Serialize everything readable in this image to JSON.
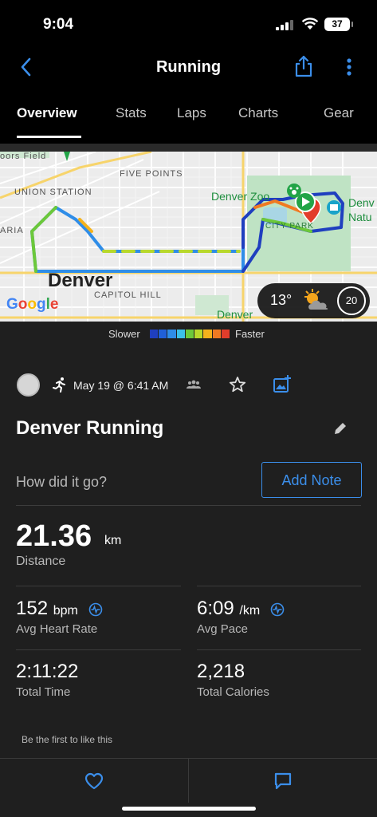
{
  "status_bar": {
    "time": "9:04",
    "battery": "37"
  },
  "header": {
    "title": "Running",
    "icons": [
      "back-chevron-icon",
      "share-icon",
      "more-vertical-icon"
    ]
  },
  "tabs": [
    {
      "label": "Overview",
      "active": true
    },
    {
      "label": "Stats",
      "active": false
    },
    {
      "label": "Laps",
      "active": false
    },
    {
      "label": "Charts",
      "active": false
    },
    {
      "label": "Gear",
      "active": false
    }
  ],
  "map": {
    "labels": {
      "coors_field": "oors Field",
      "five_points": "FIVE POINTS",
      "union_station": "UNION STATION",
      "aria": "ARIA",
      "denver_zoo": "Denver Zoo",
      "denver_nature": "Denv",
      "denver_nature2": "Natu",
      "city_park": "CITY PARK",
      "city": "Denver",
      "capitol_hill": "CAPITOL HILL",
      "denver_bottom": "Denver"
    },
    "attribution": "Google",
    "weather": {
      "temperature": "13°",
      "wind": "20"
    }
  },
  "legend": {
    "slower": "Slower",
    "faster": "Faster",
    "colors": [
      "#1f3fbf",
      "#2060d8",
      "#2f8de8",
      "#3cc0e8",
      "#6cc83a",
      "#b8d82c",
      "#f4b21c",
      "#f07a22",
      "#e23d2b"
    ]
  },
  "activity": {
    "date": "May 19 @ 6:41 AM",
    "title": "Denver Running",
    "prompt": "How did it go?",
    "add_note": "Add Note",
    "distance": {
      "value": "21.36",
      "unit": "km",
      "label": "Distance"
    },
    "heart_rate": {
      "value": "152",
      "unit": "bpm",
      "label": "Avg Heart Rate"
    },
    "pace": {
      "value": "6:09",
      "unit": "/km",
      "label": "Avg Pace"
    },
    "time": {
      "value": "2:11:22",
      "label": "Total Time"
    },
    "calories": {
      "value": "2,218",
      "label": "Total Calories"
    },
    "likes_text": "Be the first to like this"
  },
  "accent_color": "#3b8eea"
}
